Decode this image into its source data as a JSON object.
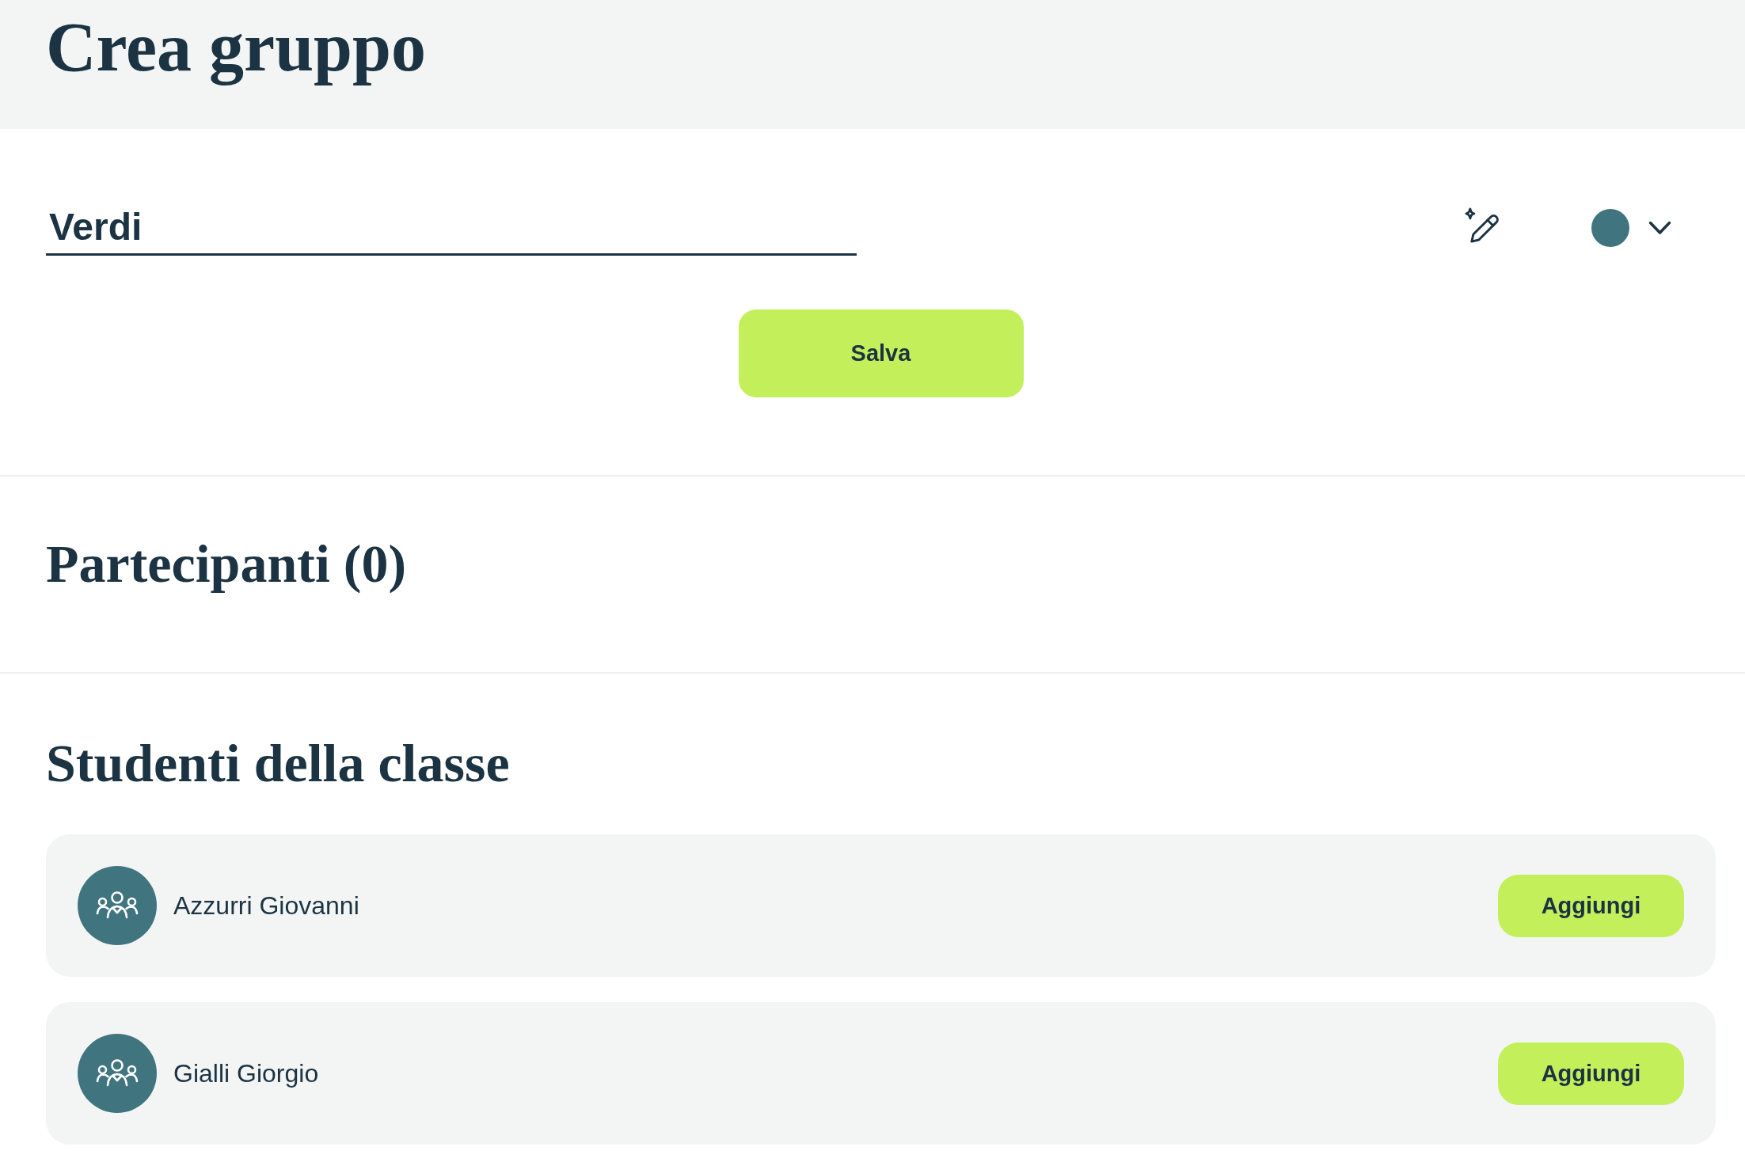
{
  "header": {
    "title": "Crea gruppo"
  },
  "group_form": {
    "name_field": {
      "value": "Verdi"
    },
    "color_picker": {
      "color": "#407580"
    },
    "save_button": {
      "label": "Salva"
    }
  },
  "participants": {
    "title": "Partecipanti (0)"
  },
  "class_students": {
    "title": "Studenti della classe",
    "students": [
      {
        "name": "Azzurri Giovanni",
        "add_button": "Aggiungi"
      },
      {
        "name": "Gialli Giorgio",
        "add_button": "Aggiungi"
      }
    ]
  }
}
